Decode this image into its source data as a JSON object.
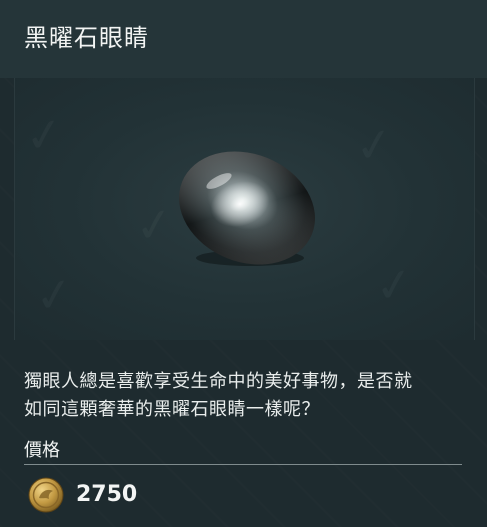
{
  "item": {
    "title": "黑曜石眼睛",
    "description_lines": [
      "獨眼人總是喜歡享受生命中的美好事物，是否就",
      "如同這顆奢華的黑曜石眼睛一樣呢？"
    ],
    "image_icon": "obsidian-gem-icon"
  },
  "price": {
    "label": "價格",
    "value": "2750",
    "currency_icon": "gold-coin-icon"
  },
  "colors": {
    "background": "#1e2b2f",
    "header": "#253539",
    "text": "#e9edec",
    "coin": "#c9a24b"
  }
}
